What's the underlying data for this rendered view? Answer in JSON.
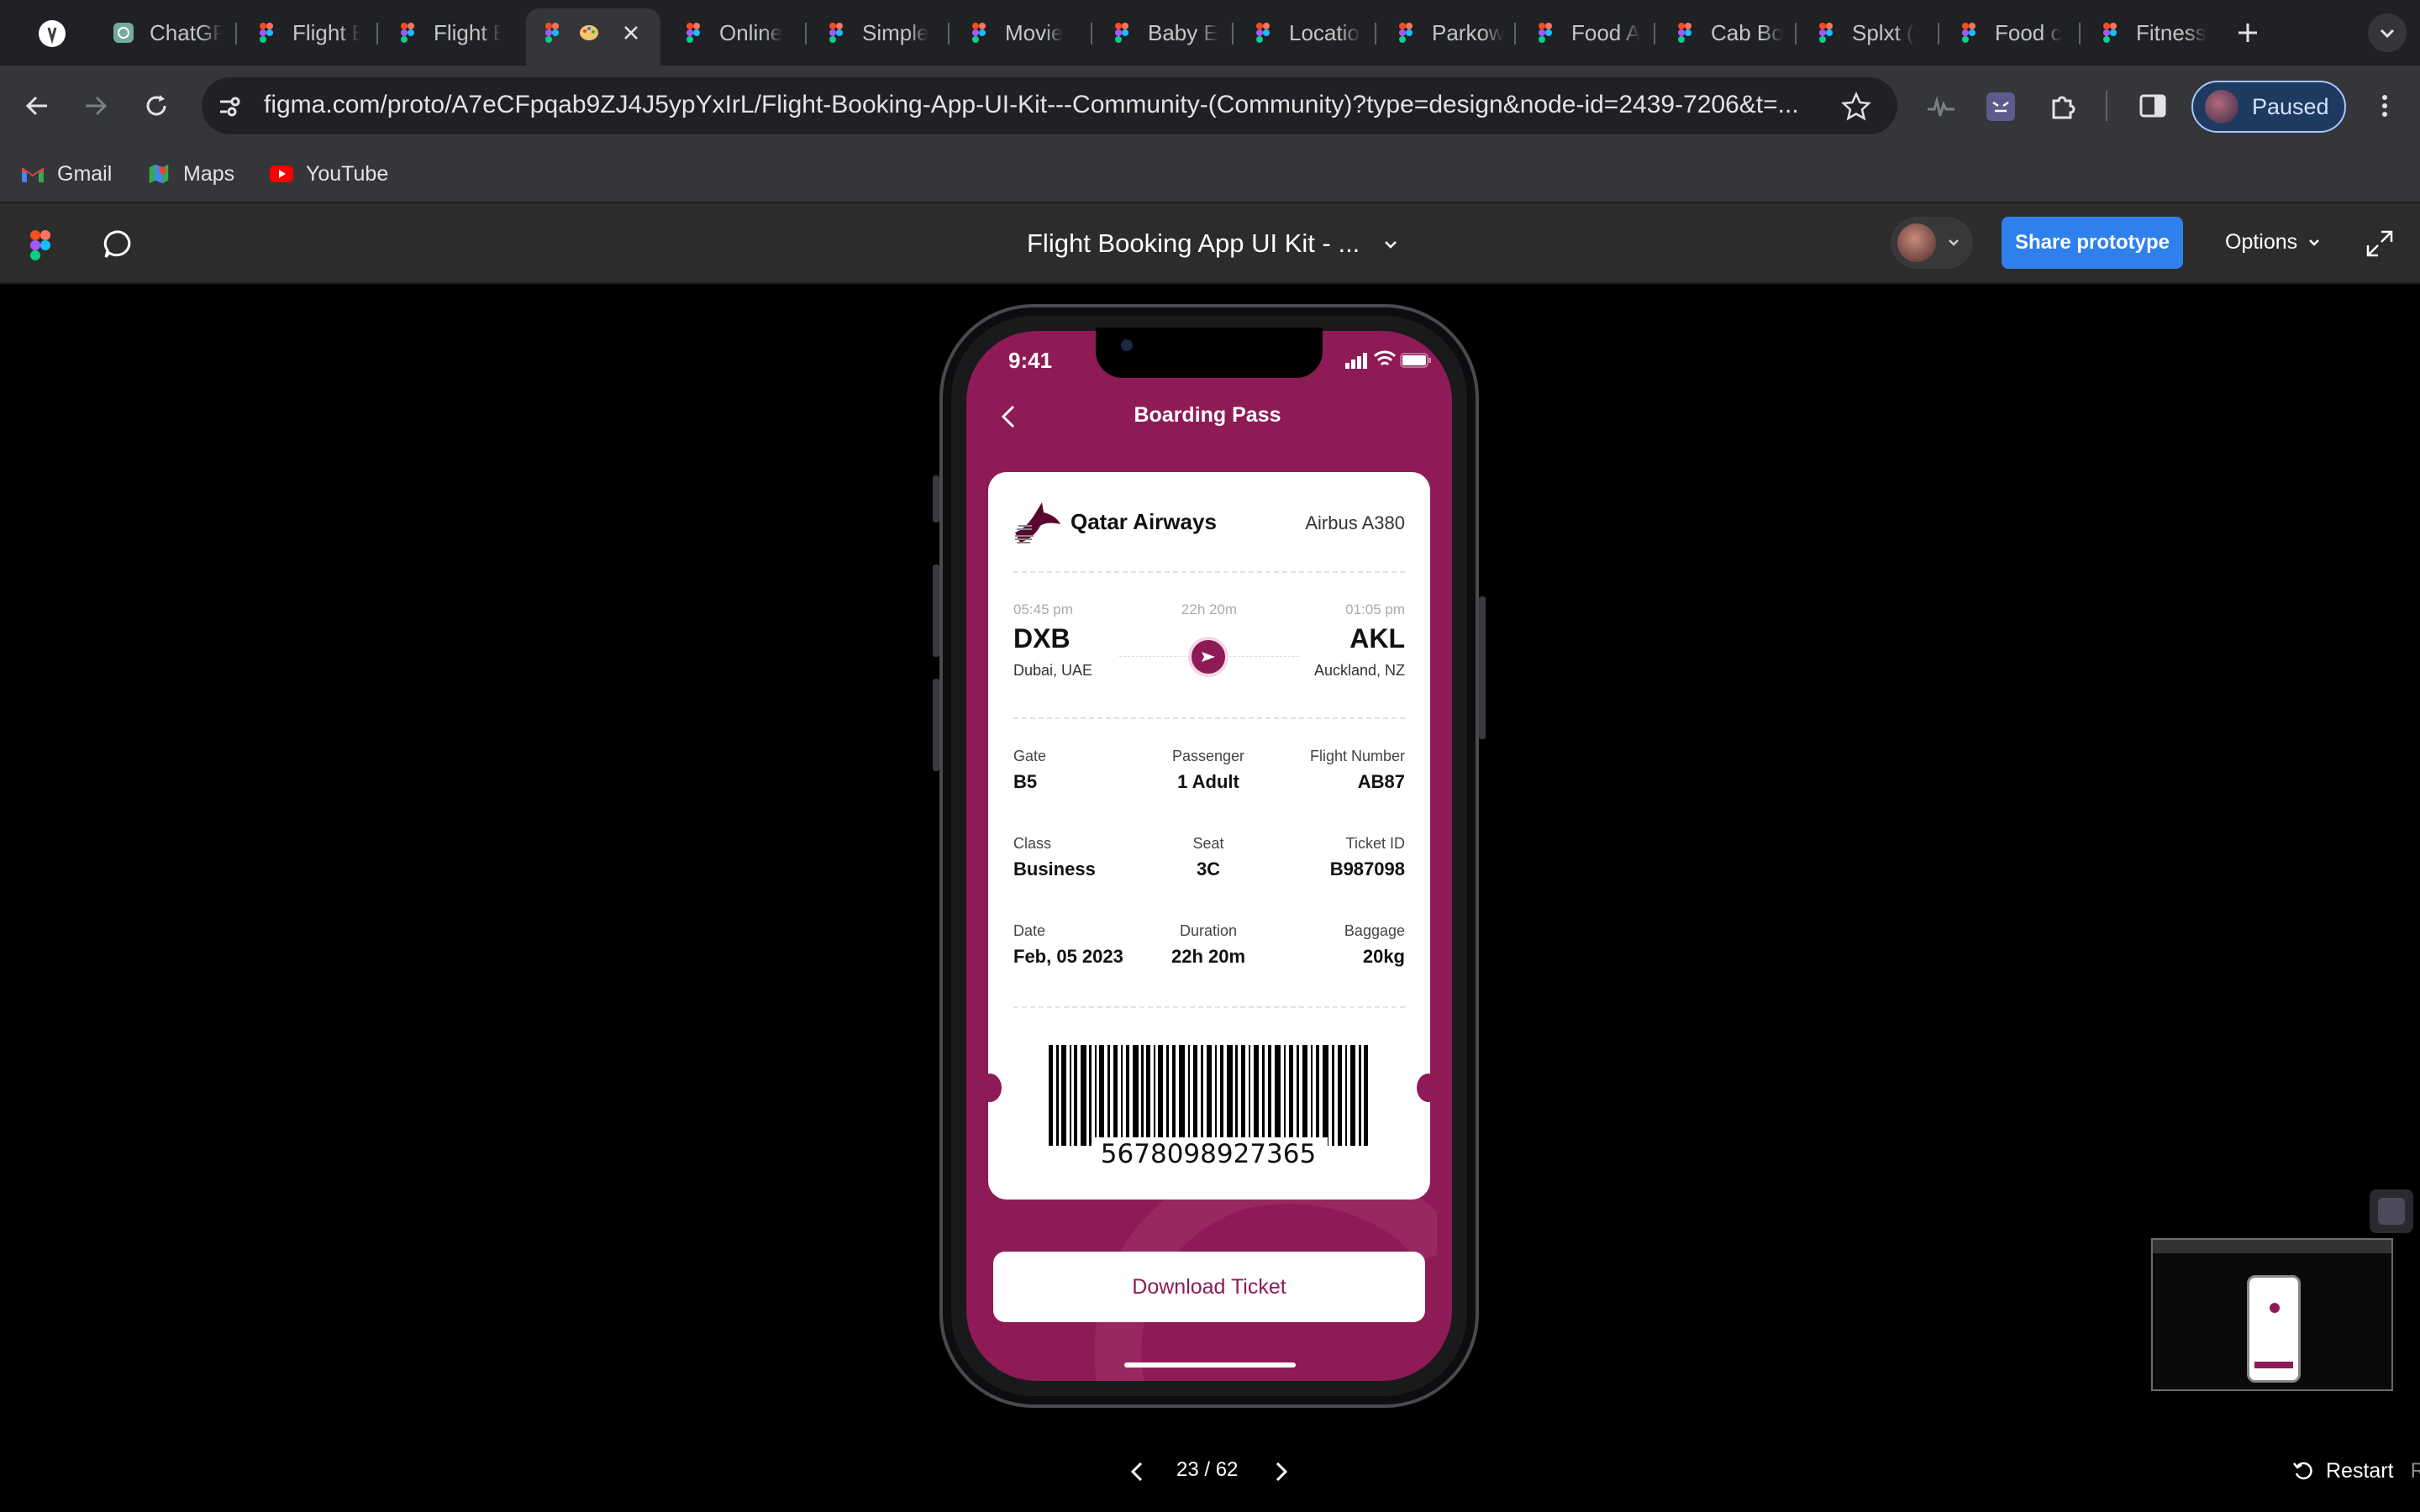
{
  "browser": {
    "tabs": [
      {
        "label": "ChatGPT",
        "icon": "chatgpt-icon"
      },
      {
        "label": "Flight Booking",
        "icon": "figma-icon"
      },
      {
        "label": "Flight Booking",
        "icon": "figma-icon"
      },
      {
        "label": "",
        "icon": "figma-icon",
        "active": true
      },
      {
        "label": "Online",
        "icon": "figma-icon"
      },
      {
        "label": "Simple",
        "icon": "figma-icon"
      },
      {
        "label": "Movie",
        "icon": "figma-icon"
      },
      {
        "label": "Baby E",
        "icon": "figma-icon"
      },
      {
        "label": "Location",
        "icon": "figma-icon"
      },
      {
        "label": "Parkow",
        "icon": "figma-icon"
      },
      {
        "label": "Food A",
        "icon": "figma-icon"
      },
      {
        "label": "Cab Bo",
        "icon": "figma-icon"
      },
      {
        "label": "Splxt (",
        "icon": "figma-icon"
      },
      {
        "label": "Food c",
        "icon": "figma-icon"
      },
      {
        "label": "Fitness",
        "icon": "figma-icon"
      }
    ],
    "url": "figma.com/proto/A7eCFpqab9ZJ4J5ypYxIrL/Flight-Booking-App-UI-Kit---Community-(Community)?type=design&node-id=2439-7206&t=...",
    "profile_label": "Paused",
    "bookmarks": [
      {
        "label": "Gmail",
        "icon": "gmail-icon"
      },
      {
        "label": "Maps",
        "icon": "maps-icon"
      },
      {
        "label": "YouTube",
        "icon": "youtube-icon"
      }
    ]
  },
  "figma": {
    "title": "Flight Booking App UI Kit - ...",
    "share_label": "Share prototype",
    "options_label": "Options",
    "pager": "23 / 62",
    "restart_label": "Restart",
    "restart_shortcut": "R"
  },
  "app": {
    "status_time": "9:41",
    "header_title": "Boarding Pass",
    "airline": "Qatar Airways",
    "aircraft": "Airbus A380",
    "departure": {
      "time": "05:45 pm",
      "code": "DXB",
      "city": "Dubai, UAE"
    },
    "arrival": {
      "time": "01:05 pm",
      "code": "AKL",
      "city": "Auckland, NZ"
    },
    "duration_short": "22h 20m",
    "details": [
      [
        {
          "label": "Gate",
          "value": "B5"
        },
        {
          "label": "Passenger",
          "value": "1 Adult"
        },
        {
          "label": "Flight Number",
          "value": "AB87"
        }
      ],
      [
        {
          "label": "Class",
          "value": "Business"
        },
        {
          "label": "Seat",
          "value": "3C"
        },
        {
          "label": "Ticket ID",
          "value": "B987098"
        }
      ],
      [
        {
          "label": "Date",
          "value": "Feb, 05 2023"
        },
        {
          "label": "Duration",
          "value": "22h 20m"
        },
        {
          "label": "Baggage",
          "value": "20kg"
        }
      ]
    ],
    "barcode_number": "5678098927365",
    "download_label": "Download Ticket"
  },
  "colors": {
    "brand": "#8e1b55",
    "accent": "#2f80ed"
  }
}
